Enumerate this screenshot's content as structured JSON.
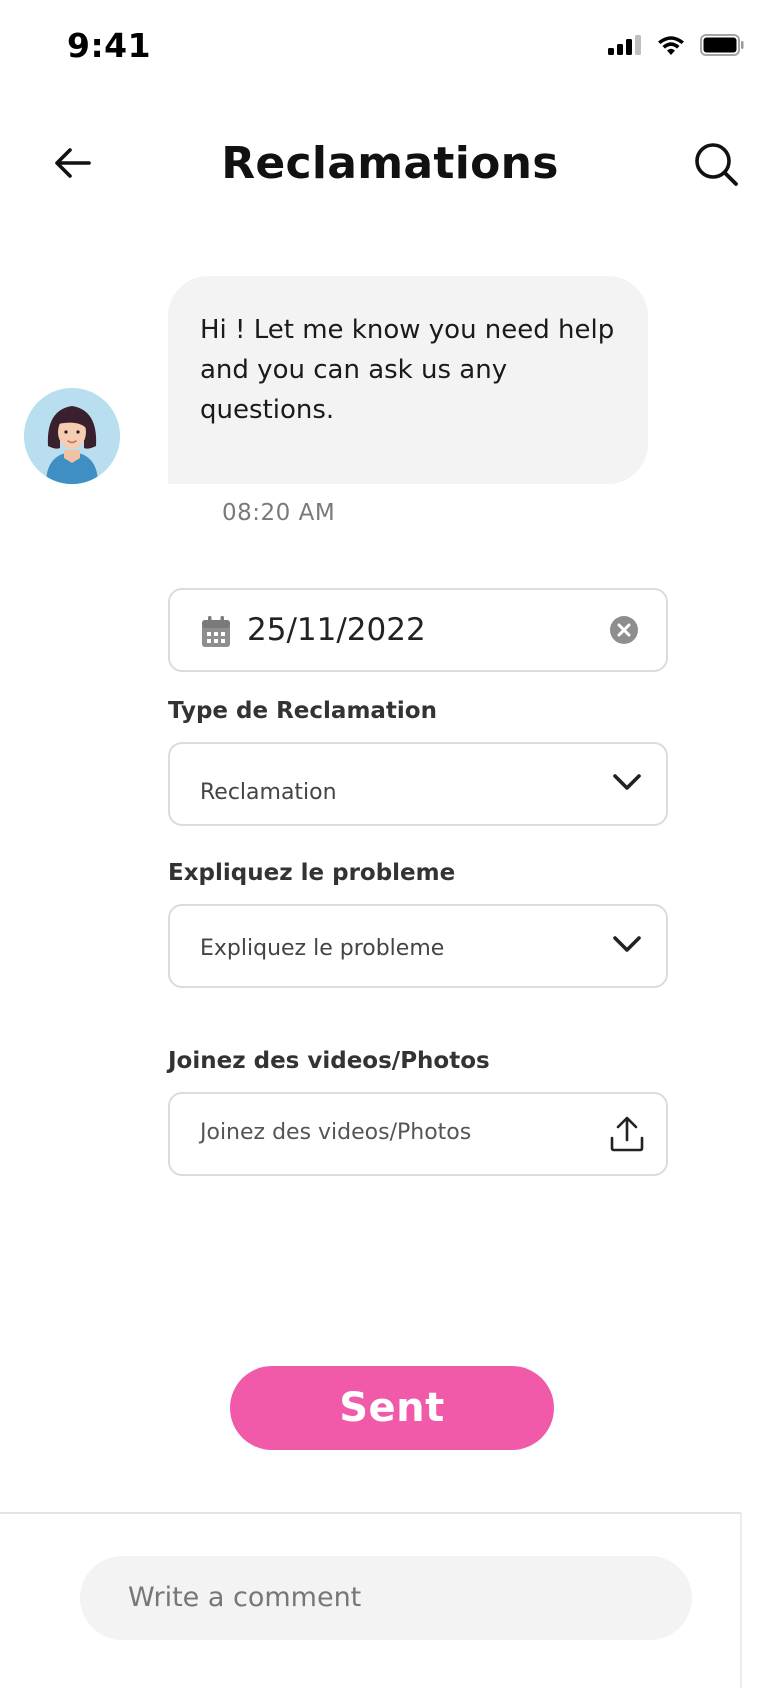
{
  "status": {
    "time": "9:41",
    "icons": [
      "signal-icon",
      "wifi-icon",
      "battery-icon"
    ]
  },
  "header": {
    "title": "Reclamations",
    "back_icon": "arrow-left-icon",
    "search_icon": "search-icon"
  },
  "chat": {
    "message": "Hi ! Let me know you need help and you can ask us any questions.",
    "time": "08:20 AM"
  },
  "form": {
    "date_value": "25/11/2022",
    "type_label": "Type de Reclamation",
    "type_value": "Reclamation",
    "explain_label": "Expliquez le probleme",
    "explain_placeholder": "Expliquez le probleme",
    "attach_label": "Joinez des videos/Photos",
    "attach_placeholder": "Joinez des videos/Photos",
    "submit_label": "Sent"
  },
  "comment": {
    "placeholder": "Write a comment"
  },
  "colors": {
    "accent": "#f05aa8",
    "bubble": "#f3f3f3",
    "border": "#dcdcdc"
  }
}
